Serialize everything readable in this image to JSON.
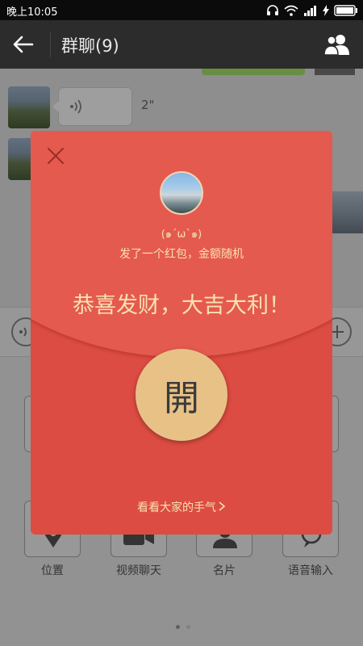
{
  "status_bar": {
    "time": "晚上10:05"
  },
  "header": {
    "title": "群聊(9)"
  },
  "chat": {
    "voice_duration": "2\""
  },
  "tools": [
    {
      "label": "位置"
    },
    {
      "label": "视频聊天"
    },
    {
      "label": "名片"
    },
    {
      "label": "语音输入"
    }
  ],
  "red_packet": {
    "sender_name": "(๑´ω`๑)",
    "subtitle": "发了一个红包，金额随机",
    "greeting": "恭喜发财，大吉大利！",
    "open_label": "開",
    "see_all_label": "看看大家的手气",
    "colors": {
      "packet": "#dd4c42",
      "flap": "#e55a4e",
      "button": "#e8c187",
      "text": "#f7e1b3"
    }
  }
}
